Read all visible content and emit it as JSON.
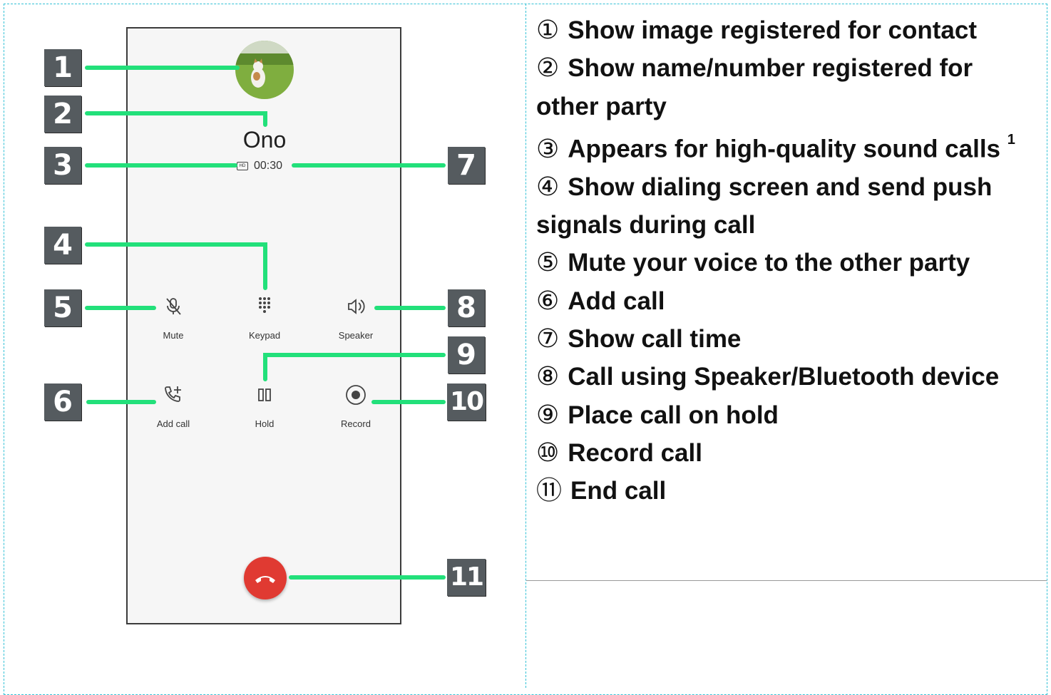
{
  "screen": {
    "contact_name": "Ono",
    "call_time": "00:30",
    "buttons": {
      "mute": "Mute",
      "keypad": "Keypad",
      "speaker": "Speaker",
      "add_call": "Add call",
      "hold": "Hold",
      "record": "Record"
    }
  },
  "callouts": [
    "1",
    "2",
    "3",
    "4",
    "5",
    "6",
    "7",
    "8",
    "9",
    "10",
    "11"
  ],
  "legend": [
    {
      "num": "①",
      "text": "Show image registered for contact"
    },
    {
      "num": "②",
      "text": "Show name/number registered for other party"
    },
    {
      "num": "③",
      "text": "Appears for high-quality sound calls",
      "sup": "1"
    },
    {
      "num": "④",
      "text": "Show dialing screen and send push signals during call"
    },
    {
      "num": "⑤",
      "text": "Mute your voice to the other party"
    },
    {
      "num": "⑥",
      "text": "Add call"
    },
    {
      "num": "⑦",
      "text": "Show call time"
    },
    {
      "num": "⑧",
      "text": "Call using Speaker/Bluetooth device"
    },
    {
      "num": "⑨",
      "text": "Place call on hold"
    },
    {
      "num": "⑩",
      "text": "Record call"
    },
    {
      "num": "⑪",
      "text": "End call"
    }
  ],
  "colors": {
    "callout_line": "#22e07a",
    "badge": "#555b5f",
    "end_call": "#e03a32"
  }
}
